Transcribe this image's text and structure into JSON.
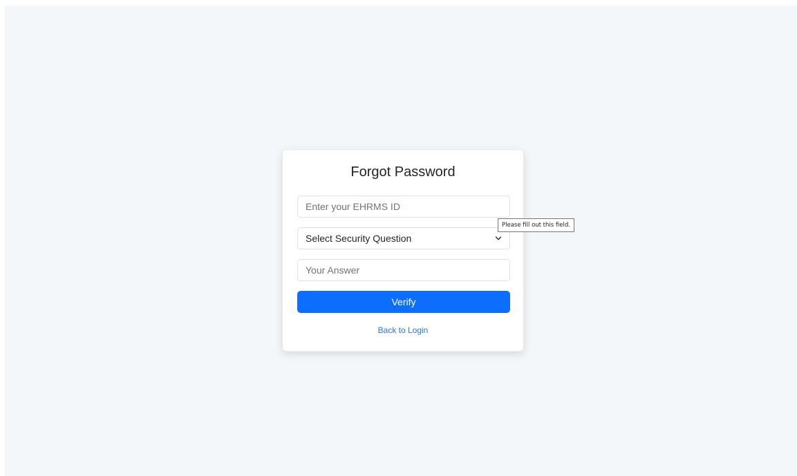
{
  "form": {
    "title": "Forgot Password",
    "ehrms_id": {
      "value": "",
      "placeholder": "Enter your EHRMS ID"
    },
    "security_question": {
      "selected": "Select Security Question",
      "icon": "chevron-down-icon"
    },
    "answer": {
      "value": "",
      "placeholder": "Your Answer"
    },
    "verify_label": "Verify",
    "back_link_label": "Back to Login"
  },
  "validation_tooltip": {
    "text": "Please fill out this field."
  },
  "colors": {
    "background": "#f4f7fa",
    "primary": "#0d6efd",
    "link": "#2a75d8"
  }
}
